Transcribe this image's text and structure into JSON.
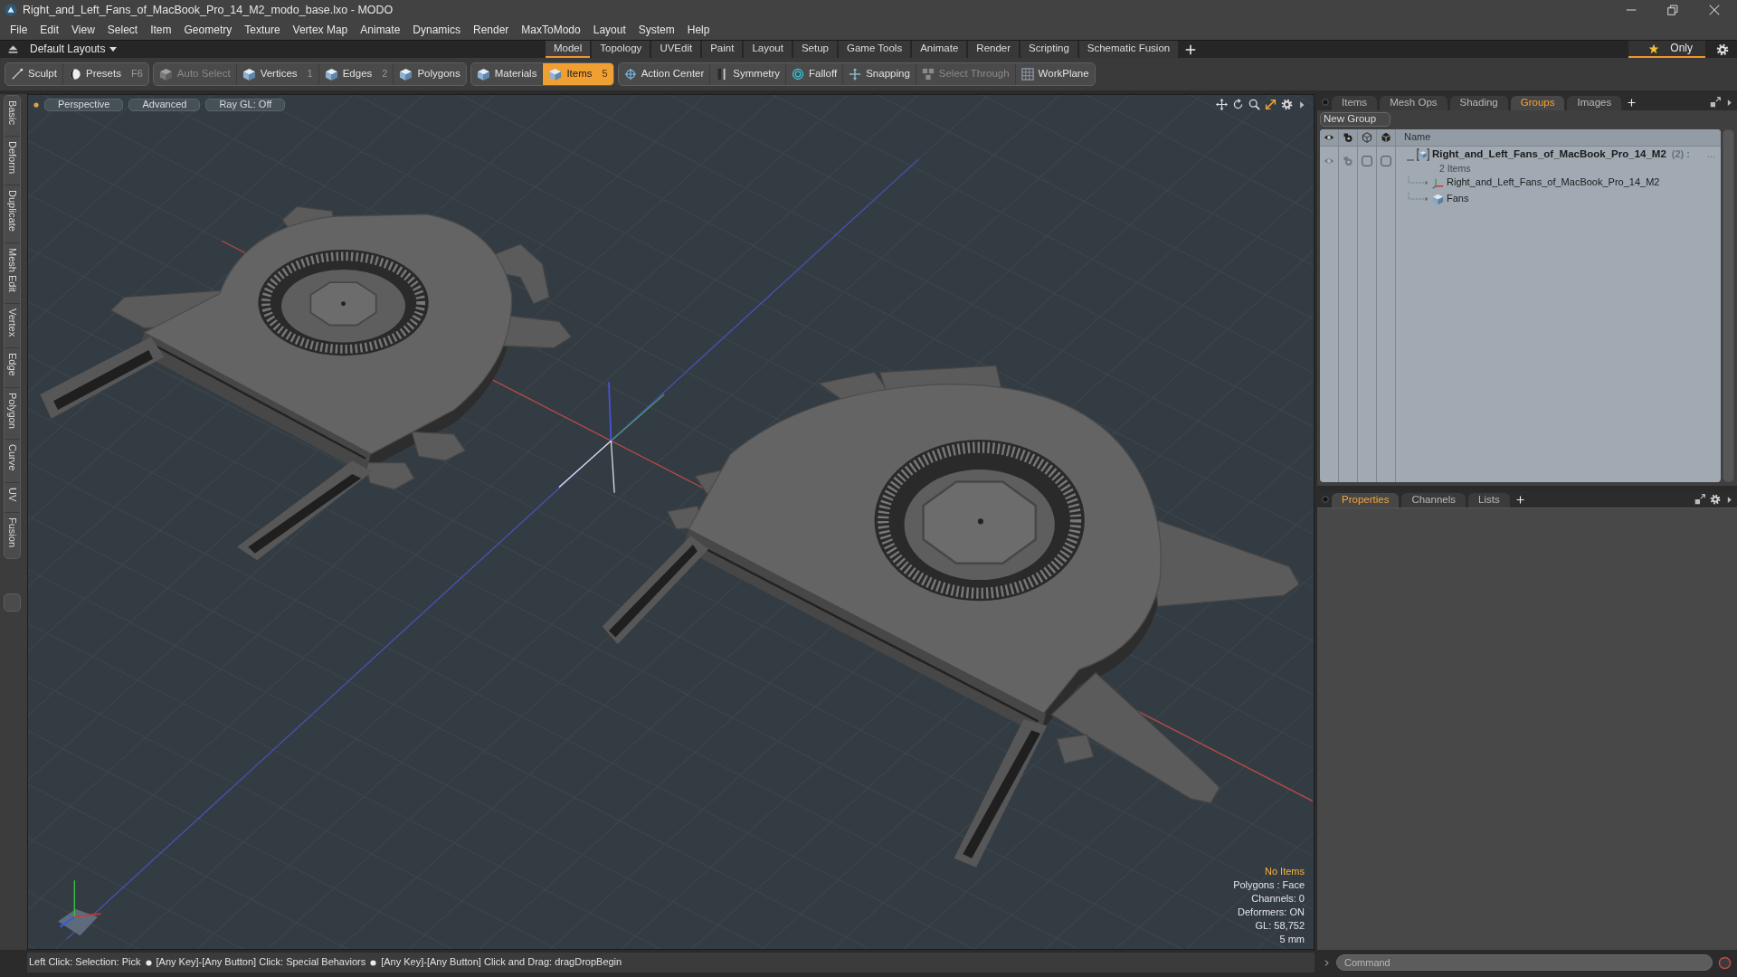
{
  "window": {
    "title": "Right_and_Left_Fans_of_MacBook_Pro_14_M2_modo_base.lxo - MODO"
  },
  "menu": [
    "File",
    "Edit",
    "View",
    "Select",
    "Item",
    "Geometry",
    "Texture",
    "Vertex Map",
    "Animate",
    "Dynamics",
    "Render",
    "MaxToModo",
    "Layout",
    "System",
    "Help"
  ],
  "layout_bar": {
    "preset": "Default Layouts",
    "tabs": [
      {
        "label": "Model",
        "selected": true
      },
      {
        "label": "Topology",
        "selected": false
      },
      {
        "label": "UVEdit",
        "selected": false
      },
      {
        "label": "Paint",
        "selected": false
      },
      {
        "label": "Layout",
        "selected": false
      },
      {
        "label": "Setup",
        "selected": false
      },
      {
        "label": "Game Tools",
        "selected": false
      },
      {
        "label": "Animate",
        "selected": false
      },
      {
        "label": "Render",
        "selected": false
      },
      {
        "label": "Scripting",
        "selected": false
      },
      {
        "label": "Schematic Fusion",
        "selected": false
      }
    ],
    "filter": {
      "label": "Only",
      "on": true
    }
  },
  "toolbar": {
    "groups": [
      {
        "items": [
          {
            "kind": "tool",
            "label": "Sculpt",
            "selected": false,
            "disabled": false
          },
          {
            "kind": "preset",
            "label": "Presets",
            "shortcut": "F6",
            "selected": false,
            "disabled": false
          }
        ]
      },
      {
        "items": [
          {
            "kind": "mode",
            "label": "Auto Select",
            "selected": false,
            "disabled": true
          },
          {
            "kind": "mode",
            "label": "Vertices",
            "shortcut": "1",
            "selected": false,
            "disabled": false
          },
          {
            "kind": "mode",
            "label": "Edges",
            "shortcut": "2",
            "selected": false,
            "disabled": false
          },
          {
            "kind": "mode",
            "label": "Polygons",
            "selected": false,
            "disabled": false
          }
        ]
      },
      {
        "items": [
          {
            "kind": "mode",
            "label": "Materials",
            "selected": false,
            "disabled": false
          },
          {
            "kind": "mode",
            "label": "Items",
            "shortcut": "5",
            "selected": true,
            "disabled": false
          }
        ]
      },
      {
        "items": [
          {
            "kind": "pivot",
            "label": "Action Center",
            "selected": false,
            "disabled": false
          },
          {
            "kind": "symmetry",
            "label": "Symmetry",
            "selected": false,
            "disabled": false
          },
          {
            "kind": "falloff",
            "label": "Falloff",
            "selected": false,
            "disabled": false
          },
          {
            "kind": "snap",
            "label": "Snapping",
            "selected": false,
            "disabled": false
          },
          {
            "kind": "through",
            "label": "Select Through",
            "selected": false,
            "disabled": true
          },
          {
            "kind": "workplane",
            "label": "WorkPlane",
            "selected": false,
            "disabled": false
          }
        ]
      }
    ]
  },
  "side_tabs": [
    "Basic",
    "Deform",
    "Duplicate",
    "Mesh Edit",
    "Vertex",
    "Edge",
    "Polygon",
    "Curve",
    "UV",
    "Fusion"
  ],
  "viewport": {
    "buttons": [
      "Perspective",
      "Advanced",
      "Ray GL: Off"
    ],
    "info_title": "No Items",
    "info": [
      "Polygons : Face",
      "Channels: 0",
      "Deformers: ON",
      "GL: 58,752",
      "5 mm"
    ]
  },
  "items_panel": {
    "tabs": [
      {
        "label": "Items",
        "selected": false
      },
      {
        "label": "Mesh Ops",
        "selected": false
      },
      {
        "label": "Shading",
        "selected": false
      },
      {
        "label": "Groups",
        "selected": true
      },
      {
        "label": "Images",
        "selected": false
      }
    ],
    "new_group": "New Group",
    "columns": [
      "Name"
    ],
    "tree": [
      {
        "kind": "group",
        "name": "Right_and_Left_Fans_of_MacBook_Pro_14_M2",
        "count": "(2) :",
        "more": "...",
        "subtitle": "2 Items",
        "expanded": true,
        "children": [
          {
            "kind": "locator",
            "name": "Right_and_Left_Fans_of_MacBook_Pro_14_M2"
          },
          {
            "kind": "mesh",
            "name": "Fans"
          }
        ]
      }
    ]
  },
  "properties_panel": {
    "tabs": [
      {
        "label": "Properties",
        "selected": true
      },
      {
        "label": "Channels",
        "selected": false
      },
      {
        "label": "Lists",
        "selected": false
      }
    ]
  },
  "status_bar": {
    "hints": [
      "Left Click: Selection: Pick",
      "[Any Key]-[Any Button] Click: Special Behaviors",
      "[Any Key]-[Any Button] Click and Drag: dragDropBegin"
    ]
  },
  "command": {
    "placeholder": "Command"
  }
}
